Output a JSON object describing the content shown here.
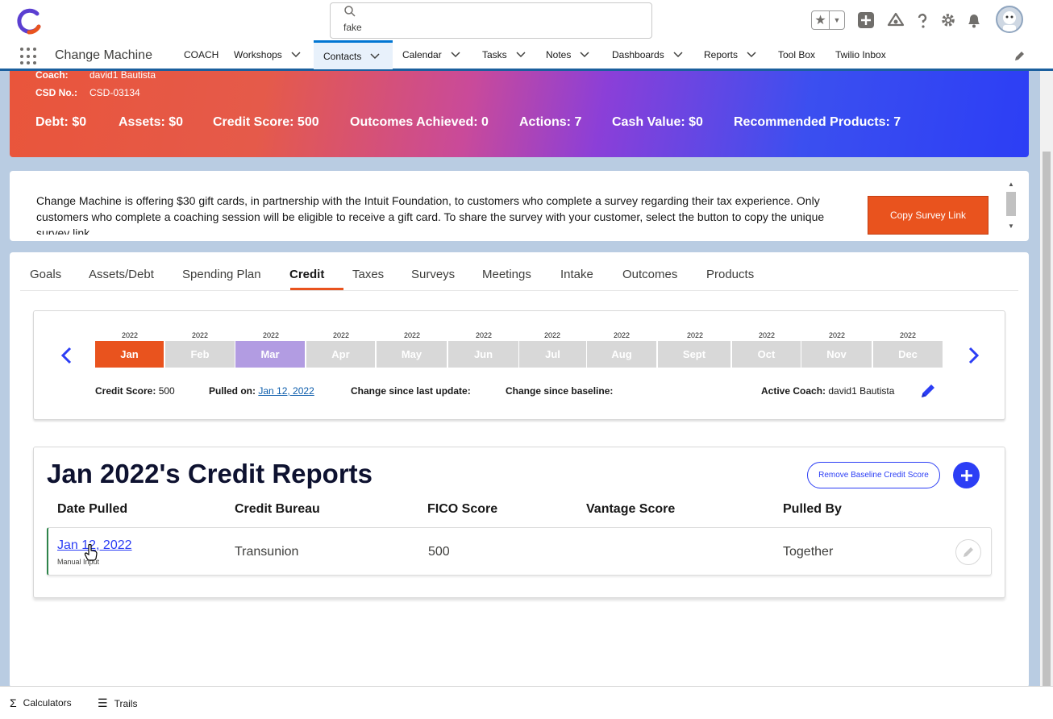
{
  "header": {
    "search_value": "fake",
    "icons": [
      "favorites-star-icon",
      "add-plus-icon",
      "trailhead-icon",
      "help-icon",
      "setup-gear-icon",
      "notifications-bell-icon",
      "user-avatar"
    ]
  },
  "nav": {
    "app_name": "Change Machine",
    "items": [
      {
        "label": "COACH",
        "chevron": false
      },
      {
        "label": "Workshops",
        "chevron": true
      },
      {
        "label": "Contacts",
        "chevron": true,
        "active": true
      },
      {
        "label": "Calendar",
        "chevron": true
      },
      {
        "label": "Tasks",
        "chevron": true
      },
      {
        "label": "Notes",
        "chevron": true
      },
      {
        "label": "Dashboards",
        "chevron": true
      },
      {
        "label": "Reports",
        "chevron": true
      },
      {
        "label": "Tool Box",
        "chevron": false
      },
      {
        "label": "Twilio Inbox",
        "chevron": false
      }
    ]
  },
  "banner": {
    "coach_label": "Coach:",
    "coach_value": "david1 Bautista",
    "csd_label": "CSD No.:",
    "csd_value": "CSD-03134",
    "stats": [
      "Debt: $0",
      "Assets: $0",
      "Credit Score: 500",
      "Outcomes Achieved: 0",
      "Actions: 7",
      "Cash Value: $0",
      "Recommended Products: 7"
    ]
  },
  "notice": {
    "text": "Change Machine is offering $30 gift cards, in partnership with the Intuit Foundation, to customers who complete a survey regarding their tax experience. Only customers who complete a coaching session will be eligible to receive a gift card. To share the survey with your customer, select the button to copy the unique survey link.",
    "button": "Copy Survey Link"
  },
  "tabs": [
    "Goals",
    "Assets/Debt",
    "Spending Plan",
    "Credit",
    "Taxes",
    "Surveys",
    "Meetings",
    "Intake",
    "Outcomes",
    "Products"
  ],
  "active_tab": "Credit",
  "months": {
    "year": "2022",
    "items": [
      "Jan",
      "Feb",
      "Mar",
      "Apr",
      "May",
      "Jun",
      "Jul",
      "Aug",
      "Sept",
      "Oct",
      "Nov",
      "Dec"
    ],
    "selected": "Jan",
    "highlighted": "Mar"
  },
  "credit_info": {
    "score_label": "Credit Score:",
    "score_value": "500",
    "pulled_label": "Pulled on:",
    "pulled_value": "Jan 12, 2022",
    "change_update_label": "Change since last update:",
    "change_baseline_label": "Change since baseline:",
    "coach_label": "Active Coach:",
    "coach_value": "david1 Bautista"
  },
  "reports": {
    "title": "Jan 2022's Credit Reports",
    "remove_button": "Remove Baseline Credit Score",
    "columns": [
      "Date Pulled",
      "Credit Bureau",
      "FICO Score",
      "Vantage Score",
      "Pulled By"
    ],
    "rows": [
      {
        "date": "Jan 12, 2022",
        "sub": "Manual Input",
        "bureau": "Transunion",
        "fico": "500",
        "vantage": "",
        "pulled_by": "Together"
      }
    ]
  },
  "utility": {
    "items": [
      "Calculators",
      "Trails"
    ]
  },
  "colors": {
    "accent_orange": "#e9531e",
    "brand_blue": "#2c3ef5",
    "highlight_purple": "#b29ce2"
  }
}
